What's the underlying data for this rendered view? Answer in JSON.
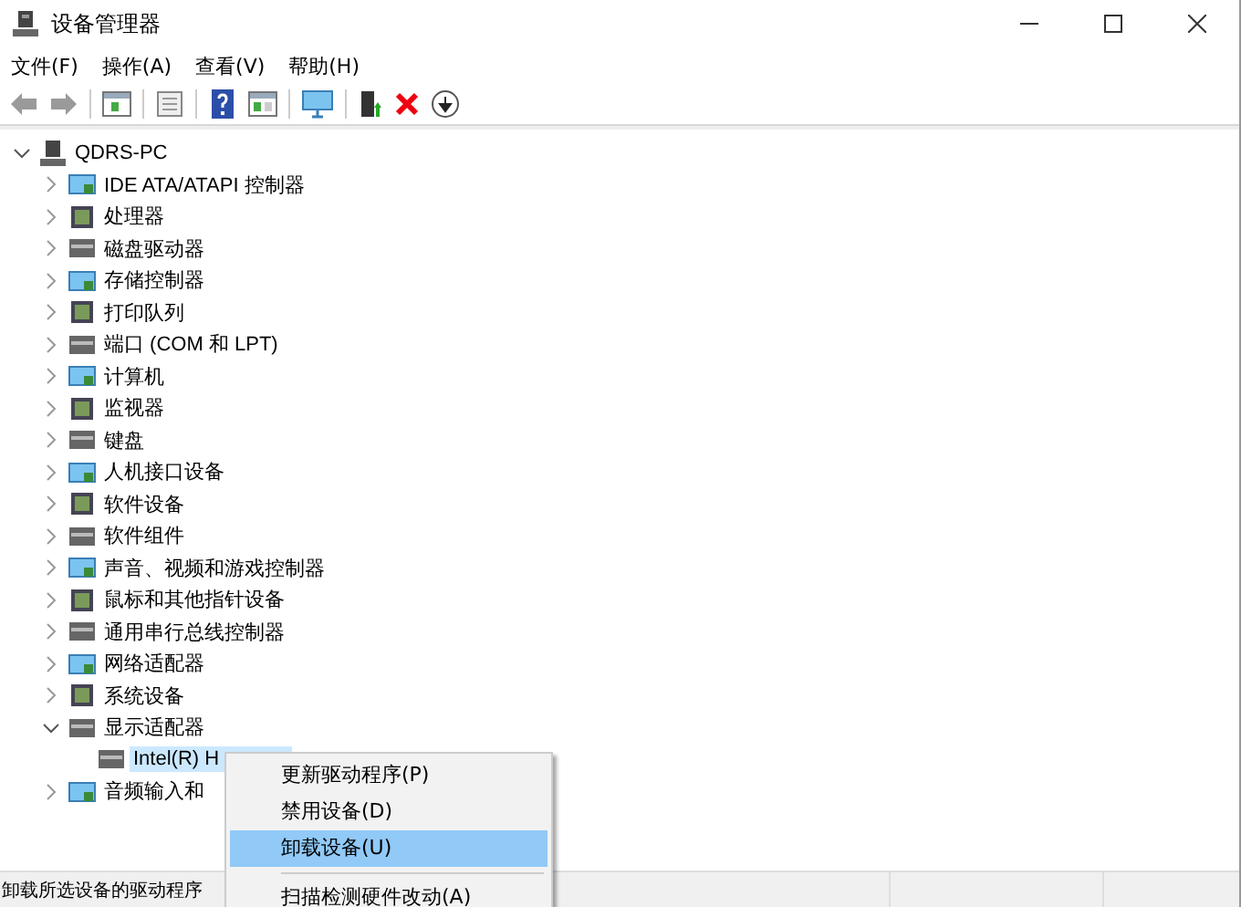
{
  "window": {
    "title": "设备管理器"
  },
  "menu_bar": [
    "文件(F)",
    "操作(A)",
    "查看(V)",
    "帮助(H)"
  ],
  "tree": {
    "label": "QDRS-PC",
    "expanded": true,
    "selected": false,
    "children": [
      {
        "label": "IDE ATA/ATAPI 控制器",
        "expanded": false,
        "selected": false
      },
      {
        "label": "处理器",
        "expanded": false,
        "selected": false
      },
      {
        "label": "磁盘驱动器",
        "expanded": false,
        "selected": false
      },
      {
        "label": "存储控制器",
        "expanded": false,
        "selected": false
      },
      {
        "label": "打印队列",
        "expanded": false,
        "selected": false
      },
      {
        "label": "端口 (COM 和 LPT)",
        "expanded": false,
        "selected": false
      },
      {
        "label": "计算机",
        "expanded": false,
        "selected": false
      },
      {
        "label": "监视器",
        "expanded": false,
        "selected": false
      },
      {
        "label": "键盘",
        "expanded": false,
        "selected": false
      },
      {
        "label": "人机接口设备",
        "expanded": false,
        "selected": false
      },
      {
        "label": "软件设备",
        "expanded": false,
        "selected": false
      },
      {
        "label": "软件组件",
        "expanded": false,
        "selected": false
      },
      {
        "label": "声音、视频和游戏控制器",
        "expanded": false,
        "selected": false
      },
      {
        "label": "鼠标和其他指针设备",
        "expanded": false,
        "selected": false
      },
      {
        "label": "通用串行总线控制器",
        "expanded": false,
        "selected": false
      },
      {
        "label": "网络适配器",
        "expanded": false,
        "selected": false
      },
      {
        "label": "系统设备",
        "expanded": false,
        "selected": false
      },
      {
        "label": "显示适配器",
        "expanded": true,
        "selected": false,
        "children": [
          {
            "label": "Intel(R) H",
            "selected": true
          }
        ]
      },
      {
        "label": "音频输入和",
        "expanded": false,
        "selected": false
      }
    ]
  },
  "context_menu": [
    {
      "kind": "item",
      "label": "更新驱动程序(P)",
      "selected": false
    },
    {
      "kind": "item",
      "label": "禁用设备(D)",
      "selected": false
    },
    {
      "kind": "item",
      "label": "卸载设备(U)",
      "selected": true
    },
    {
      "kind": "separator"
    },
    {
      "kind": "item",
      "label": "扫描检测硬件改动(A)",
      "selected": false
    }
  ],
  "status_bar": {
    "text": "卸载所选设备的驱动程序"
  }
}
